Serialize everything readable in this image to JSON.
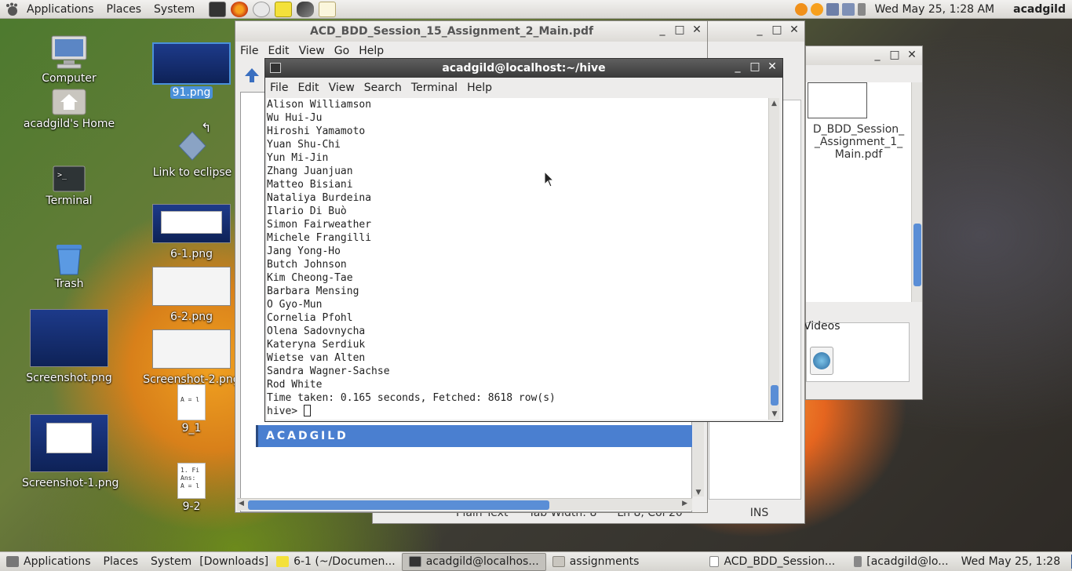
{
  "top_panel": {
    "menus": [
      "Applications",
      "Places",
      "System"
    ],
    "clock": "Wed May 25,  1:28 AM",
    "user": "acadgild"
  },
  "desktop": {
    "icons": [
      {
        "label": "Computer"
      },
      {
        "label": "acadgild's Home"
      },
      {
        "label": "Terminal"
      },
      {
        "label": "Trash"
      },
      {
        "label": "Screenshot.png"
      },
      {
        "label": "Screenshot-1.png"
      },
      {
        "label": "91.png"
      },
      {
        "label": "Link to eclipse"
      },
      {
        "label": "6-1.png"
      },
      {
        "label": "6-2.png"
      },
      {
        "label": "Screenshot-2.png"
      },
      {
        "label": "9_1",
        "preview": [
          "A = l"
        ]
      },
      {
        "label": "9-2",
        "preview": [
          "1. Fi",
          "Ans:",
          "A = l"
        ]
      }
    ]
  },
  "pdf_window": {
    "title": "ACD_BDD_Session_15_Assignment_2_Main.pdf",
    "menus": [
      "File",
      "Edit",
      "View",
      "Go",
      "Help"
    ],
    "banner": "ACADGILD"
  },
  "back_window": {
    "status": {
      "mode": "Plain Text",
      "tab_width": "Tab Width:  8",
      "position": "Ln 8, Col 20",
      "ins": "INS"
    }
  },
  "files_window": {
    "file_label": "D_BDD_Session_\n_Assignment_1_\nMain.pdf",
    "videos": "Videos"
  },
  "terminal": {
    "title": "acadgild@localhost:~/hive",
    "menus": [
      "File",
      "Edit",
      "View",
      "Search",
      "Terminal",
      "Help"
    ],
    "lines": [
      "Alison Williamson",
      "Wu Hui-Ju",
      "Hiroshi Yamamoto",
      "Yuan Shu-Chi",
      "Yun Mi-Jin",
      "Zhang Juanjuan",
      "Matteo Bisiani",
      "Nataliya Burdeina",
      "Ilario Di Buò",
      "Simon Fairweather",
      "Michele Frangilli",
      "Jang Yong-Ho",
      "Butch Johnson",
      "Kim Cheong-Tae",
      "Barbara Mensing",
      "O Gyo-Mun",
      "Cornelia Pfohl",
      "Olena Sadovnycha",
      "Kateryna Serdiuk",
      "Wietse van Alten",
      "Sandra Wagner-Sachse",
      "Rod White",
      "Time taken: 0.165 seconds, Fetched: 8618 row(s)"
    ],
    "prompt": "hive> "
  },
  "taskbar": {
    "items": [
      {
        "label": "Applications"
      },
      {
        "label": "Places"
      },
      {
        "label": "System"
      },
      {
        "label": "[Downloads]"
      },
      {
        "label": "6-1 (~/Documen..."
      },
      {
        "label": "acadgild@localhos..."
      },
      {
        "label": "assignments"
      },
      {
        "label": "ACD_BDD_Session..."
      },
      {
        "label": "[acadgild@lo..."
      },
      {
        "label": "Wed May 25,  1:28"
      }
    ]
  },
  "colors": {
    "selection": "#4a90d9",
    "banner": "#4a7fd0",
    "scroll_thumb": "#5a8ed6"
  }
}
